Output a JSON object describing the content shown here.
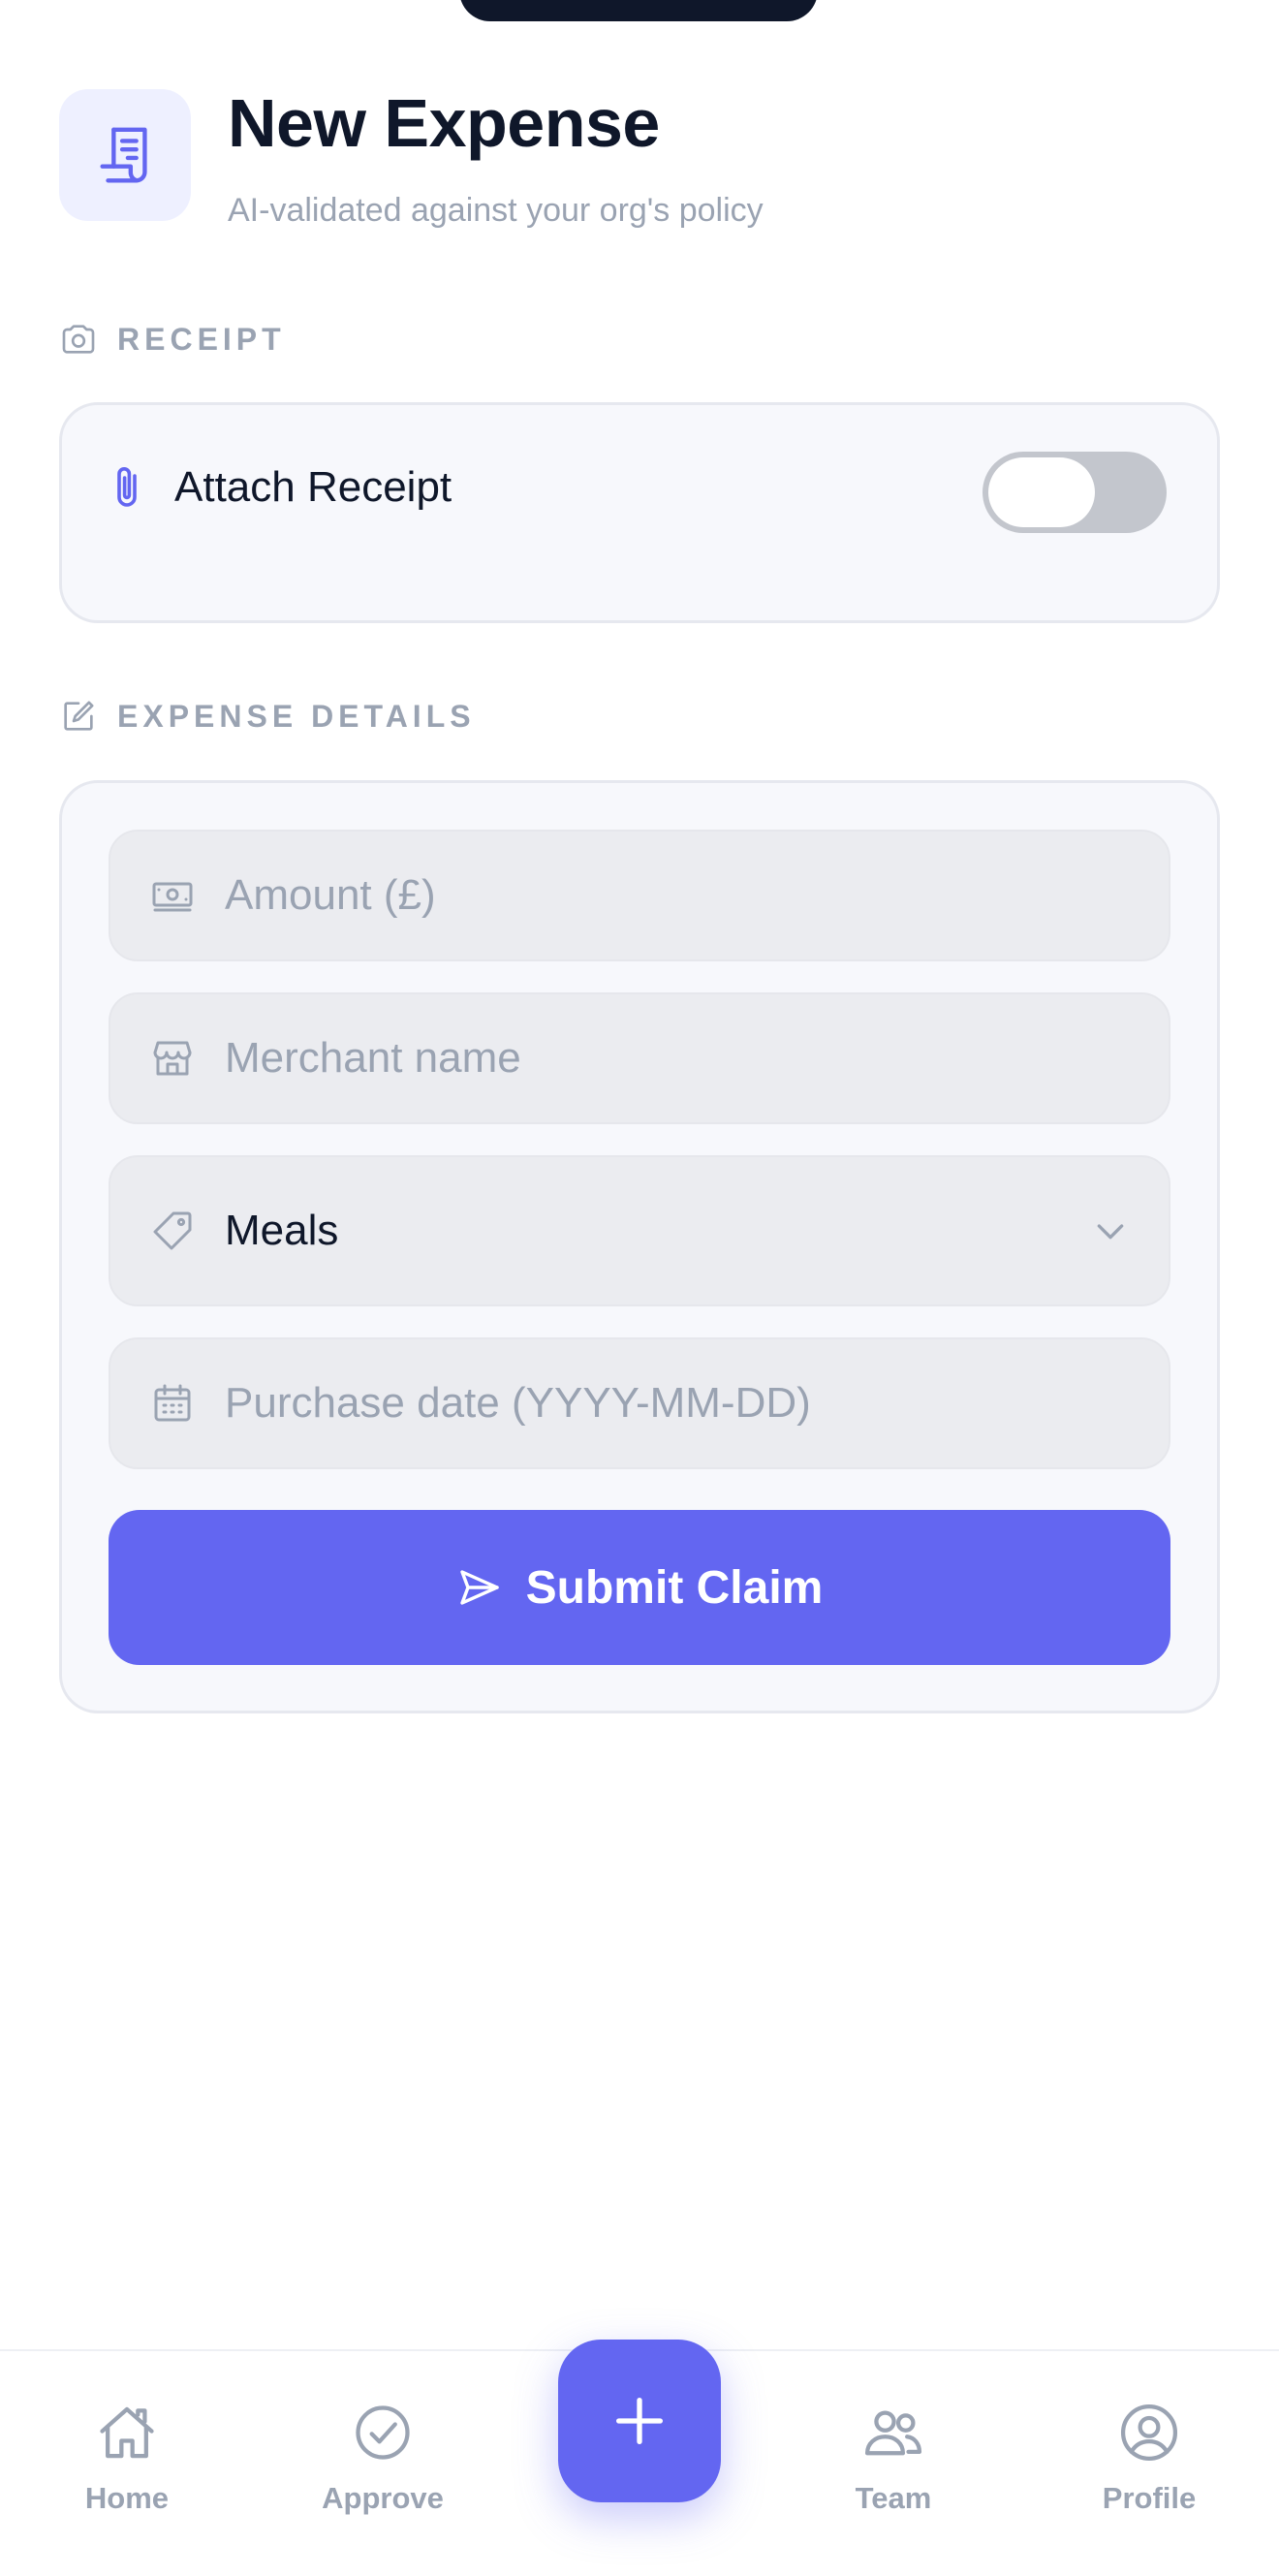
{
  "header": {
    "title": "New Expense",
    "subtitle": "AI-validated against your org's policy",
    "icon": "receipt-icon"
  },
  "receipt_section": {
    "label": "RECEIPT",
    "icon": "camera-icon",
    "attach_label": "Attach Receipt",
    "attach_icon": "paperclip-icon",
    "toggle_on": false
  },
  "details_section": {
    "label": "EXPENSE DETAILS",
    "icon": "edit-icon",
    "amount_placeholder": "Amount (£)",
    "merchant_placeholder": "Merchant name",
    "category_value": "Meals",
    "date_placeholder": "Purchase date (YYYY-MM-DD)",
    "submit_label": "Submit Claim"
  },
  "tabbar": {
    "items": [
      {
        "label": "Home",
        "icon": "home-icon"
      },
      {
        "label": "Approve",
        "icon": "check-circle-icon"
      },
      {
        "label": "Team",
        "icon": "users-icon"
      },
      {
        "label": "Profile",
        "icon": "user-circle-icon"
      }
    ],
    "fab_icon": "plus-icon"
  },
  "colors": {
    "accent": "#6366f1",
    "muted": "#9aa3b2",
    "text": "#0f172a"
  }
}
